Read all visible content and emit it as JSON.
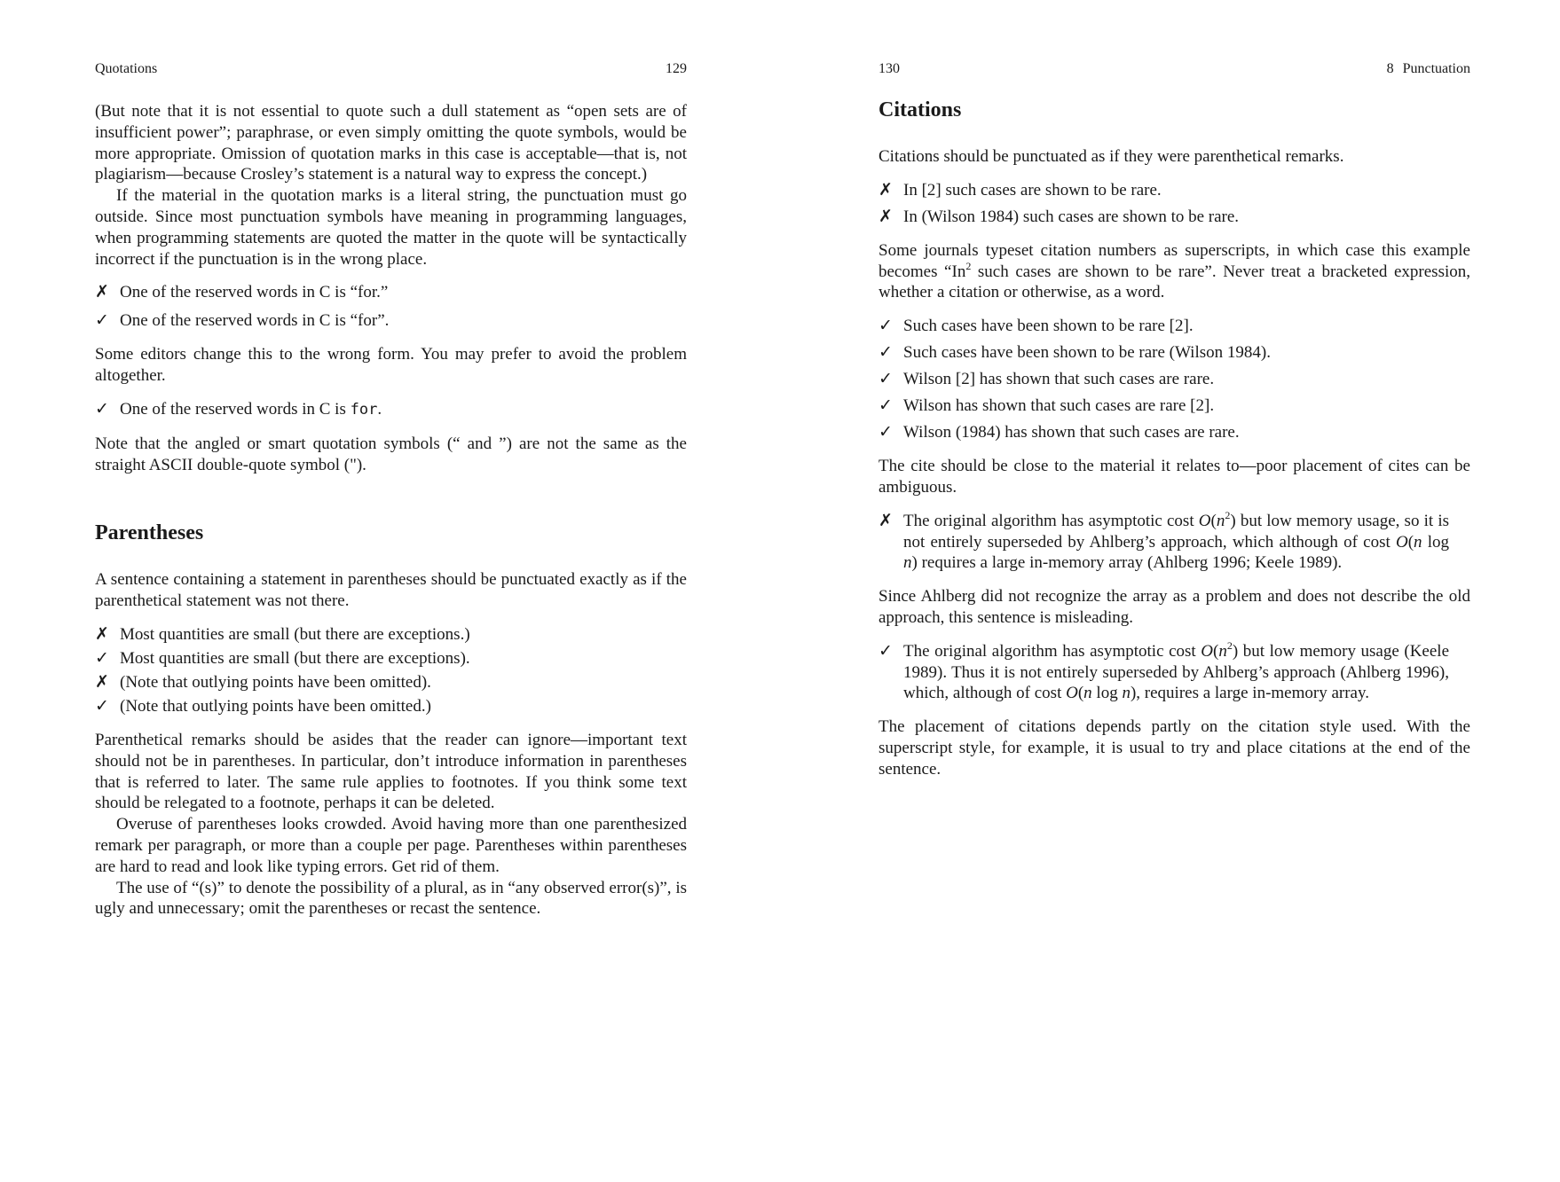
{
  "left_page": {
    "running_head": {
      "title": "Quotations",
      "page_number": "129"
    },
    "p1": "(But note that it is not essential to quote such a dull statement as “open sets are of insufficient power”; paraphrase, or even simply omitting the quote symbols, would be more appropriate. Omission of quotation marks in this case is acceptable—that is, not plagiarism—because Crosley’s statement is a natural way to express the concept.)",
    "p2": "If the material in the quotation marks is a literal string, the punctuation must go outside. Since most punctuation symbols have meaning in programming languages, when programming statements are quoted the matter in the quote will be syntactically incorrect if the punctuation is in the wrong place.",
    "examples1": [
      {
        "mark": "✗",
        "text": "One of the reserved words in C is “for.”"
      },
      {
        "mark": "✓",
        "text": "One of the reserved words in C is “for”."
      }
    ],
    "p3": "Some editors change this to the wrong form. You may prefer to avoid the problem altogether.",
    "example2": {
      "mark": "✓",
      "text": "One of the reserved words in C is ",
      "code": "for",
      "end": "."
    },
    "p4": "Note that the angled or smart quotation symbols (“ and ”) are not the same as the straight ASCII double-quote symbol (\").",
    "heading": "Parentheses",
    "p5": "A sentence containing a statement in parentheses should be punctuated exactly as if the parenthetical statement was not there.",
    "examples3": [
      {
        "mark": "✗",
        "text": "Most quantities are small (but there are exceptions.)"
      },
      {
        "mark": "✓",
        "text": "Most quantities are small (but there are exceptions)."
      },
      {
        "mark": "✗",
        "text": "(Note that outlying points have been omitted)."
      },
      {
        "mark": "✓",
        "text": "(Note that outlying points have been omitted.)"
      }
    ],
    "p6": "Parenthetical remarks should be asides that the reader can ignore—important text should not be in parentheses. In particular, don’t introduce information in parentheses that is referred to later. The same rule applies to footnotes. If you think some text should be relegated to a footnote, perhaps it can be deleted.",
    "p7": "Overuse of parentheses looks crowded. Avoid having more than one parenthesized remark per paragraph, or more than a couple per page. Parentheses within parentheses are hard to read and look like typing errors. Get rid of them.",
    "p8": "The use of “(s)” to denote the possibility of a plural, as in “any observed error(s)”, is ugly and unnecessary; omit the parentheses or recast the sentence."
  },
  "right_page": {
    "running_head": {
      "page_number": "130",
      "chapter_number": "8",
      "chapter_title": "Punctuation"
    },
    "heading": "Citations",
    "p1": "Citations should be punctuated as if they were parenthetical remarks.",
    "examples1": [
      {
        "mark": "✗",
        "text": "In [2] such cases are shown to be rare."
      },
      {
        "mark": "✗",
        "text": "In (Wilson 1984) such cases are shown to be rare."
      }
    ],
    "p2": {
      "a": "Some journals typeset citation numbers as superscripts, in which case this example becomes “In",
      "sup": "2",
      "b": " such cases are shown to be rare”. Never treat a bracketed expression, whether a citation or otherwise, as a word."
    },
    "examples2": [
      {
        "mark": "✓",
        "text": "Such cases have been shown to be rare [2]."
      },
      {
        "mark": "✓",
        "text": "Such cases have been shown to be rare (Wilson 1984)."
      },
      {
        "mark": "✓",
        "text": "Wilson [2] has shown that such cases are rare."
      },
      {
        "mark": "✓",
        "text": "Wilson has shown that such cases are rare [2]."
      },
      {
        "mark": "✓",
        "text": "Wilson (1984) has shown that such cases are rare."
      }
    ],
    "p3": "The cite should be close to the material it relates to—poor placement of cites can be ambiguous.",
    "example3": {
      "mark": "✗",
      "t1": "The original algorithm has asymptotic cost ",
      "math1_o": "O",
      "math1_open": "(",
      "math1_n": "n",
      "math1_sup": "2",
      "math1_close": ")",
      "t2": " but low memory usage, so it is not entirely superseded by Ahlberg’s approach, which although of cost ",
      "math2_o": "O",
      "math2_open": "(",
      "math2_n": "n",
      "math2_log": " log ",
      "math2_n2": "n",
      "math2_close": ")",
      "t3": " requires a large in-memory array (Ahlberg 1996; Keele 1989)."
    },
    "p4": "Since Ahlberg did not recognize the array as a problem and does not describe the old approach, this sentence is misleading.",
    "example4": {
      "mark": "✓",
      "t1": "The original algorithm has asymptotic cost ",
      "math1_o": "O",
      "math1_open": "(",
      "math1_n": "n",
      "math1_sup": "2",
      "math1_close": ")",
      "t2": " but low memory usage (Keele 1989). Thus it is not entirely superseded by Ahlberg’s approach (Ahlberg 1996), which, although of cost ",
      "math2_o": "O",
      "math2_open": "(",
      "math2_n": "n",
      "math2_log": " log ",
      "math2_n2": "n",
      "math2_close": ")",
      "t3": ", requires a large in-memory array."
    },
    "p5": "The placement of citations depends partly on the citation style used. With the superscript style, for example, it is usual to try and place citations at the end of the sentence."
  }
}
